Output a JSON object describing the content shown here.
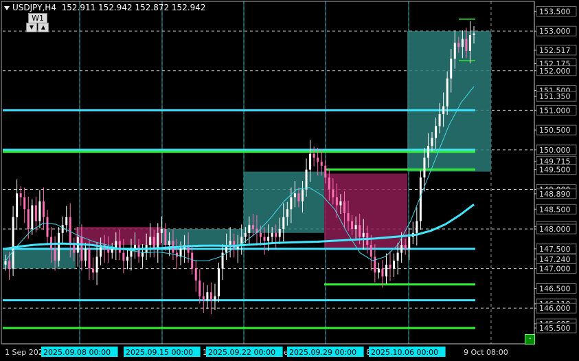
{
  "header": {
    "symbol": "USDJPY,H4",
    "ohlc": "152.911 152.942 152.872 152.942",
    "tf_button": "W1",
    "down_arrow": "▼",
    "up_arrow": "▲",
    "minimize": "-"
  },
  "colors": {
    "background": "#000000",
    "bull": "#ffffff",
    "bear": "#ff6eb4",
    "hline_cyan": "#40e0ff",
    "hline_green": "#33ee33",
    "zone_teal": "#2a7a78",
    "zone_magenta": "#8c1c54",
    "ma_fast": "#40d8e8",
    "ma_slow": "#40e8ff"
  },
  "chart_data": {
    "type": "candlestick",
    "symbol": "USDJPY",
    "timeframe": "H4",
    "ylim": [
      145.1,
      153.75
    ],
    "y_ticks": [
      "153.500",
      "153.000",
      "152.517",
      "152.175",
      "152.000",
      "151.500",
      "151.350",
      "151.000",
      "150.500",
      "150.000",
      "149.715",
      "149.500",
      "149.000",
      "148.890",
      "148.500",
      "148.065",
      "148.000",
      "147.500",
      "147.240",
      "147.000",
      "146.500",
      "146.110",
      "146.000",
      "145.605",
      "145.500"
    ],
    "x_labels": [
      "1 Sep 202",
      "2025.09.08 00:00",
      "2025.09.15 00:00",
      "17",
      "2025.09.22 00:00",
      "e",
      "2025.09.29 00:00",
      "8",
      "2025.10.06 00:00",
      "9 Oct 08:00"
    ],
    "highlighted_x_labels": [
      "2025.09.08 00:00",
      "2025.09.15 00:00",
      "2025.09.22 00:00",
      "2025.09.29 00:00",
      "2025.10.06 00:00"
    ],
    "levels_cyan": [
      151.0,
      150.0,
      147.5,
      146.2
    ],
    "levels_green": [
      149.95,
      149.5,
      146.6,
      145.5
    ],
    "zones": [
      {
        "color": "teal",
        "from": "2025.09.01",
        "to": "2025.09.08",
        "top": 147.5,
        "bottom": 147.0
      },
      {
        "color": "magenta",
        "from": "2025.09.08",
        "to": "2025.09.15",
        "top": 148.05,
        "bottom": 147.6
      },
      {
        "color": "teal",
        "from": "2025.09.15",
        "to": "2025.09.22",
        "top": 148.0,
        "bottom": 147.6
      },
      {
        "color": "teal",
        "from": "2025.09.23",
        "to": "2025.09.29",
        "top": 149.45,
        "bottom": 147.9
      },
      {
        "color": "magenta",
        "from": "2025.09.29",
        "to": "2025.10.06",
        "top": 149.4,
        "bottom": 147.5
      },
      {
        "color": "teal",
        "from": "2025.10.06",
        "to": "2025.10.09",
        "top": 153.0,
        "bottom": 149.45
      }
    ],
    "closes": [
      147.2,
      147.0,
      148.3,
      148.9,
      148.8,
      148.5,
      148.0,
      148.6,
      148.2,
      148.7,
      148.3,
      147.8,
      147.5,
      147.2,
      147.9,
      148.1,
      148.3,
      147.6,
      147.4,
      147.8,
      147.2,
      147.5,
      147.0,
      146.9,
      147.3,
      147.6,
      147.5,
      147.4,
      147.5,
      147.7,
      147.4,
      147.2,
      147.3,
      147.5,
      147.6,
      147.3,
      147.4,
      147.6,
      147.8,
      147.5,
      147.9,
      148.0,
      147.6,
      147.7,
      147.4,
      147.3,
      147.5,
      147.6,
      147.4,
      147.0,
      146.7,
      146.3,
      146.2,
      146.4,
      146.2,
      146.3,
      147.0,
      147.4,
      147.6,
      147.7,
      147.5,
      147.6,
      147.8,
      147.9,
      148.1,
      148.0,
      147.9,
      147.8,
      147.7,
      147.8,
      147.9,
      147.8,
      148.0,
      148.3,
      148.5,
      148.8,
      148.9,
      148.7,
      149.0,
      149.5,
      149.9,
      149.8,
      149.7,
      149.6,
      149.3,
      149.0,
      148.8,
      148.6,
      148.7,
      148.4,
      148.2,
      148.0,
      148.1,
      147.8,
      147.9,
      147.6,
      147.3,
      146.9,
      147.0,
      146.8,
      147.1,
      147.0,
      147.2,
      147.4,
      147.6,
      147.5,
      147.8,
      147.9,
      148.2,
      149.3,
      149.8,
      150.1,
      150.3,
      150.6,
      150.9,
      151.1,
      151.8,
      152.3,
      152.7,
      152.6,
      152.8,
      152.5,
      152.9,
      152.94
    ],
    "ma_slow": [
      147.5,
      147.56,
      147.6,
      147.62,
      147.63,
      147.62,
      147.6,
      147.55,
      147.5,
      147.48,
      147.5,
      147.52,
      147.55,
      147.57,
      147.58,
      147.58,
      147.57,
      147.6,
      147.62,
      147.65,
      147.66,
      147.67,
      147.68,
      147.7,
      147.72,
      147.74,
      147.76,
      147.79,
      147.82,
      147.86,
      147.96,
      148.12,
      148.35,
      148.62
    ],
    "ma_fast": [
      147.2,
      147.6,
      147.95,
      148.15,
      148.12,
      147.95,
      147.8,
      147.68,
      147.6,
      147.5,
      147.45,
      147.4,
      147.42,
      147.38,
      147.3,
      147.2,
      147.2,
      147.3,
      147.5,
      147.7,
      147.95,
      148.3,
      148.7,
      149.0,
      149.05,
      148.85,
      148.5,
      147.9,
      147.4,
      147.2,
      147.3,
      147.6,
      148.2,
      149.0,
      149.8,
      150.6,
      151.2,
      151.6
    ]
  }
}
